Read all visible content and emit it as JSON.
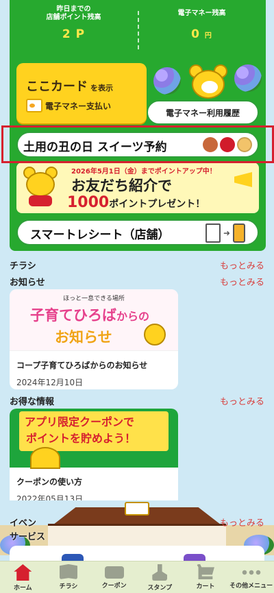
{
  "points": {
    "store_label": "昨日までの\n店舗ポイント残高",
    "store_value": "2",
    "store_unit": "P",
    "emoney_label": "電子マネー残高",
    "emoney_value": "0",
    "emoney_unit": "円"
  },
  "coco_card": {
    "title": "ここカード",
    "title_suffix": "を表示",
    "subtitle": "電子マネー支払い"
  },
  "history_button": "電子マネー利用履歴",
  "sweets_banner": "土用の丑の日 スイーツ予約",
  "friend_banner": {
    "date": "2026年5月1日（金）までポイントアップ中！",
    "line1": "お友だち紹介で",
    "line2_big": "1000",
    "line2_rest": "ポイントプレゼント！"
  },
  "receipt_banner": "スマートレシート（店舗）",
  "sections": {
    "flyer": {
      "title": "チラシ",
      "more": "もっとみる"
    },
    "news": {
      "title": "お知らせ",
      "more": "もっとみる"
    },
    "deals": {
      "title": "お得な情報",
      "more": "もっとみる"
    },
    "service": {
      "title": "サービス",
      "more": "もっとみる"
    }
  },
  "news_card": {
    "kicker": "ほっと一息できる場所",
    "headline1": "子育てひろば",
    "headline1_suffix": "からの",
    "headline2": "お知らせ",
    "title": "コープ子育てひろばからのお知らせ",
    "date": "2024年12月10日"
  },
  "deal_card": {
    "line1": "アプリ限定クーポンで",
    "line2": "ポイントを貯めよう！",
    "title": "クーポンの使い方",
    "date": "2022年05月13日"
  },
  "scene": {
    "label1": "イベン",
    "label2": "サービス"
  },
  "nav": [
    {
      "label": "ホーム",
      "icon": "home-icon"
    },
    {
      "label": "チラシ",
      "icon": "flyer-icon"
    },
    {
      "label": "クーポン",
      "icon": "coupon-icon"
    },
    {
      "label": "スタンプ",
      "icon": "stamp-icon"
    },
    {
      "label": "カート",
      "icon": "cart-icon"
    },
    {
      "label": "その他メニュー",
      "icon": "more-icon"
    }
  ],
  "colors": {
    "green": "#27a92f",
    "yellow": "#ffd21f",
    "accent_red": "#d6202f",
    "link": "#d8403f",
    "background": "#cfe9f5"
  }
}
